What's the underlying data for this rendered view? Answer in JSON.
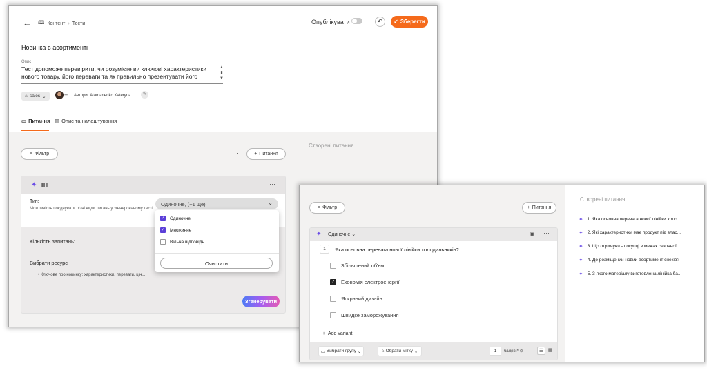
{
  "window_main": {
    "breadcrumb": {
      "back_icon": "arrow-left-icon",
      "icon": "book-icon",
      "content": "Контент",
      "tests": "Тести"
    },
    "header": {
      "publish_label": "Опублікувати",
      "save_label": "Зберегти"
    },
    "test": {
      "title": "Новинка в асортименті",
      "description_label": "Опис",
      "description": "Тест допоможе перевірити, чи розумієте ви ключові характеристики нового товару, його переваги та як правильно презентувати його"
    },
    "tag": "sales",
    "authors": "Автори: Atamanenko Kateryna",
    "tabs": {
      "questions": "Питання",
      "settings": "Опис та налаштування"
    },
    "toolbar": {
      "filter": "Фільтр",
      "add_question": "Питання"
    },
    "created_label": "Створені питання",
    "ai_card": {
      "title": "ШІ",
      "type_label": "Тип:",
      "type_help": "Можливість поєднувати різні види питань у згенерованому тесті",
      "type_value": "Одиночне, (+1 ще)",
      "count_label": "Кількість запитань:",
      "resource_label": "Вибрати ресурс",
      "resource_item": "Ключове про новинку: характеристики, переваги, цін...",
      "generate_label": "Згенерувати"
    },
    "dropdown": {
      "options": [
        {
          "label": "Одиночне",
          "checked": true
        },
        {
          "label": "Множинне",
          "checked": true
        },
        {
          "label": "Вільна відповідь",
          "checked": false
        }
      ],
      "clear_label": "Очистити"
    }
  },
  "window_question": {
    "toolbar": {
      "filter": "Фільтр",
      "add_question": "Питання"
    },
    "question": {
      "type": "Одиночне",
      "number": "1",
      "text": "Яка основна перевага нової лінійки холодильників?",
      "options": [
        {
          "label": "Збільшений об'єм",
          "checked": false
        },
        {
          "label": "Економія електроенергії",
          "checked": true
        },
        {
          "label": "Яскравий дизайн",
          "checked": false
        },
        {
          "label": "Швидке заморожування",
          "checked": false
        }
      ],
      "add_variant": "Add variant",
      "group_label": "Вибрати групу",
      "tag_label": "Обрати мітку",
      "score": "1",
      "score_label": "бал(ів)*"
    },
    "created_label": "Створені питання",
    "created_questions": [
      "1. Яка основна перевага нової лінійки холо...",
      "2. Які характеристики має продукт під влас...",
      "3. Що отримують покупці в межах сезонної...",
      "4. Де розміщений новий асортимент снеків?",
      "5. З якого матеріалу виготовлена лінійка ба..."
    ]
  },
  "colors": {
    "accent": "#f56a1b",
    "ai_purple": "#6b4de6",
    "checkbox_purple": "#5b3fd8"
  }
}
